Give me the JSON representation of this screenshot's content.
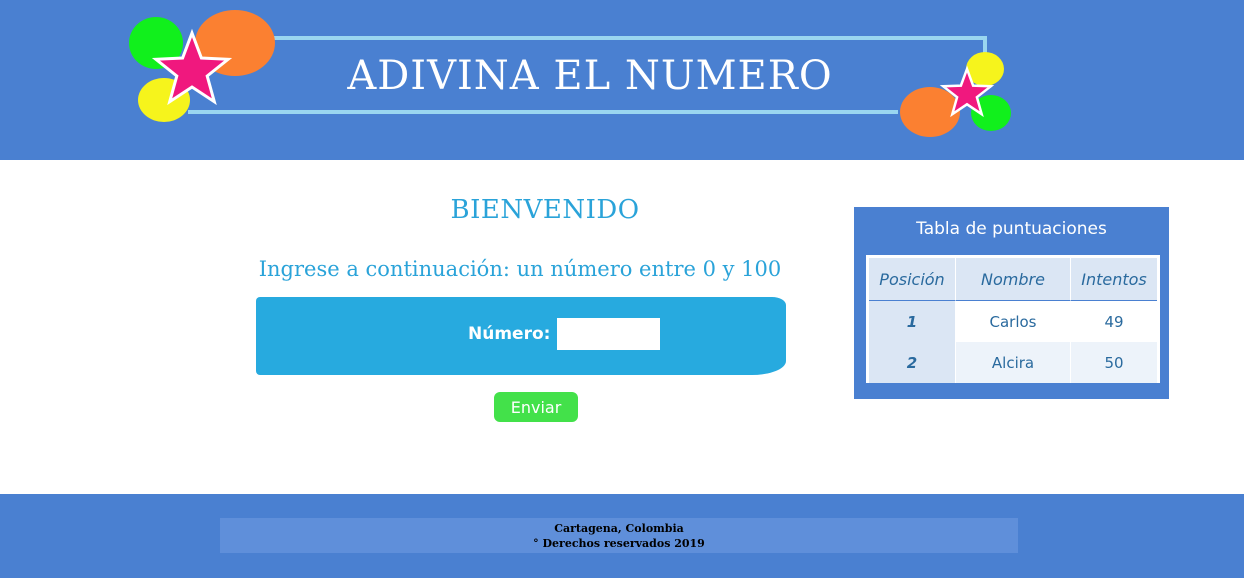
{
  "header": {
    "title": "ADIVINA EL NUMERO",
    "decor_icons": [
      "star-icon",
      "balloon-icon"
    ]
  },
  "main": {
    "welcome": "BIENVENIDO",
    "instruction": "Ingrese a continuación: un número entre 0 y 100",
    "number_label": "Número:",
    "number_value": "",
    "submit_label": "Enviar"
  },
  "scores": {
    "title": "Tabla de puntuaciones",
    "columns": [
      "Posición",
      "Nombre",
      "Intentos"
    ],
    "rows": [
      {
        "pos": "1",
        "name": "Carlos",
        "attempts": "49"
      },
      {
        "pos": "2",
        "name": "Alcira",
        "attempts": "50"
      }
    ]
  },
  "footer": {
    "location": "Cartagena, Colombia",
    "rights": "° Derechos reservados 2019"
  },
  "colors": {
    "header_bg": "#4a80d1",
    "accent": "#27aadf",
    "heading_text": "#2aa3d9",
    "button": "#43e14a",
    "balloon_green": "#11f01c",
    "balloon_orange": "#fb8031",
    "balloon_yellow": "#f6f41c",
    "star": "#f0187e"
  }
}
